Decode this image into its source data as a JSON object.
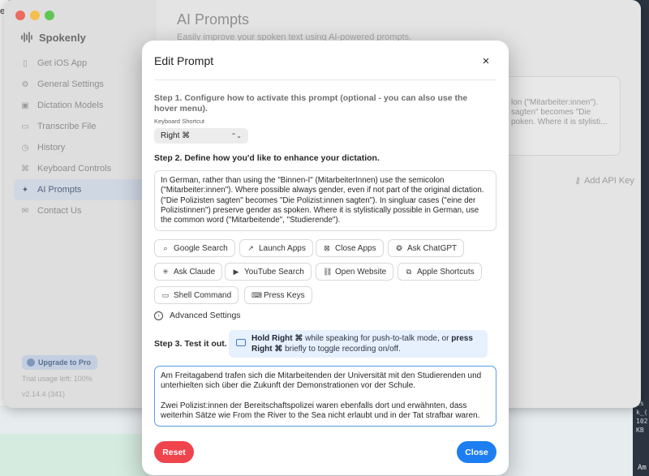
{
  "desktop": {
    "left_edge_char": "e",
    "terminal_lines": [
      "is",
      "k_(",
      "102",
      "KB"
    ],
    "terminal_bottom": "Am"
  },
  "app": {
    "name": "Spokenly",
    "sidebar": {
      "items": [
        {
          "label": "Get iOS App",
          "icon": "phone-icon"
        },
        {
          "label": "General Settings",
          "icon": "gear-icon"
        },
        {
          "label": "Dictation Models",
          "icon": "cube-icon"
        },
        {
          "label": "Transcribe File",
          "icon": "file-icon"
        },
        {
          "label": "History",
          "icon": "clock-icon"
        },
        {
          "label": "Keyboard Controls",
          "icon": "command-icon"
        },
        {
          "label": "AI Prompts",
          "icon": "sparkle-icon",
          "active": true
        },
        {
          "label": "Contact Us",
          "icon": "mail-icon"
        }
      ],
      "upgrade_label": "Upgrade to Pro",
      "trial_text": "Trial usage left: 100%",
      "version": "v2.14.4 (341)"
    },
    "main": {
      "title": "AI Prompts",
      "subtitle": "Easily improve your spoken text using AI-powered prompts.",
      "card_text_lines": [
        "lon (\"Mitarbeiter:innen\").",
        "sagten\" becomes \"Die",
        "poken. Where it is stylisti..."
      ],
      "api_key_label": "Add API Key"
    }
  },
  "modal": {
    "title": "Edit Prompt",
    "close_icon": "×",
    "step1_text": "Step 1. Configure how to activate this prompt (optional - you can also use the hover menu).",
    "keyboard_shortcut_label": "Keyboard Shortcut",
    "shortcut_value": "Right ⌘",
    "step2_text": "Step 2. Define how you'd like to enhance your dictation.",
    "prompt_text": "In German, rather than using the \"Binnen-I\" (MitarbeiterInnen) use the semicolon (\"Mitarbeiter:innen\"). Where possible always gender, even if not part of the original dictation. (\"Die Polizisten sagten\" becomes \"Die Polizist:innen sagten\"). In singluar cases (\"eine der Polizistinnen\") preserve gender as spoken. Where it is stylistically possible in German, use the common word (\"Mitarbeitende\", \"Studierende\").",
    "actions": [
      {
        "label": "Google Search",
        "icon": "search-icon",
        "glyph": "⌕"
      },
      {
        "label": "Launch Apps",
        "icon": "launch-icon",
        "glyph": "↗"
      },
      {
        "label": "Close Apps",
        "icon": "close-app-icon",
        "glyph": "⊠"
      },
      {
        "label": "Ask ChatGPT",
        "icon": "chatgpt-icon",
        "glyph": "❂"
      },
      {
        "label": "Ask Claude",
        "icon": "claude-icon",
        "glyph": "✳"
      },
      {
        "label": "YouTube Search",
        "icon": "play-icon",
        "glyph": "▶"
      },
      {
        "label": "Open Website",
        "icon": "link-icon",
        "glyph": "⛓"
      },
      {
        "label": "Apple Shortcuts",
        "icon": "shortcuts-icon",
        "glyph": "⧉"
      },
      {
        "label": "Shell Command",
        "icon": "terminal-icon",
        "glyph": "▭"
      },
      {
        "label": "Press Keys",
        "icon": "keyboard-icon",
        "glyph": "⌨"
      }
    ],
    "advanced_label": "Advanced Settings",
    "step3_text": "Step 3. Test it out.",
    "hint": {
      "bold1": "Hold Right ⌘",
      "mid": " while speaking for push-to-talk mode, or ",
      "bold2": "press Right ⌘",
      "end": " briefly to toggle recording on/off."
    },
    "test_paragraph1": "Am Freitagabend trafen sich die Mitarbeitenden der Universität mit den Studierenden und unterhielten sich über die Zukunft der Demonstrationen vor der Schule.",
    "test_paragraph2": "Zwei Polizist:innen der Bereitschaftspolizei waren ebenfalls dort und erwähnten, dass weiterhin Sätze wie From the River to the Sea nicht erlaubt und in der Tat strafbar waren.",
    "reset_label": "Reset",
    "close_label": "Close",
    "colors": {
      "reset": "#f0444d",
      "close": "#1d7ef1",
      "hint_bg": "#e7f0fd",
      "focus_border": "#5b9ae8"
    }
  }
}
